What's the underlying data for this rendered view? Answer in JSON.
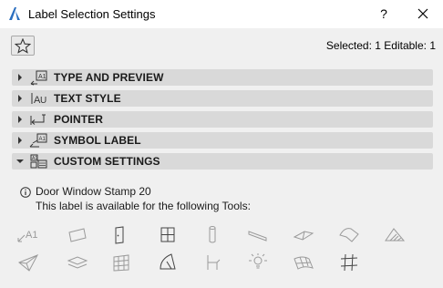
{
  "window": {
    "title": "Label Selection Settings",
    "help_label": "?"
  },
  "toolbar": {
    "selection_info": "Selected: 1 Editable: 1"
  },
  "panels": [
    {
      "label": "TYPE AND PREVIEW",
      "expanded": false,
      "icon": "type-preview-icon"
    },
    {
      "label": "TEXT STYLE",
      "expanded": false,
      "icon": "text-style-icon"
    },
    {
      "label": "POINTER",
      "expanded": false,
      "icon": "pointer-icon"
    },
    {
      "label": "SYMBOL LABEL",
      "expanded": false,
      "icon": "symbol-label-icon"
    },
    {
      "label": "CUSTOM SETTINGS",
      "expanded": true,
      "icon": "custom-settings-icon"
    }
  ],
  "custom_settings": {
    "label_name": "Door Window Stamp 20",
    "availability_text": "This label is available for the following Tools:",
    "tools_row1": [
      "label-tool-icon",
      "slab-tool-icon",
      "door-tool-icon",
      "window-tool-icon",
      "column-tool-icon",
      "beam-tool-icon",
      "roof-tool-icon",
      "shell-tool-icon",
      "fill-tool-icon"
    ],
    "tools_row2": [
      "morph-tool-icon",
      "zone-tool-icon",
      "curtain-wall-tool-icon",
      "skylight-tool-icon",
      "object-tool-icon",
      "lamp-tool-icon",
      "mesh-tool-icon",
      "grid-tool-icon"
    ],
    "label_tool_text": "A1"
  },
  "colors": {
    "titlebar": "#ffffff",
    "background": "#f0f0f0",
    "panel_bar": "#d9d9d9",
    "icon_gray": "#9a9a9a",
    "app_accent": "#2a6ebf"
  }
}
